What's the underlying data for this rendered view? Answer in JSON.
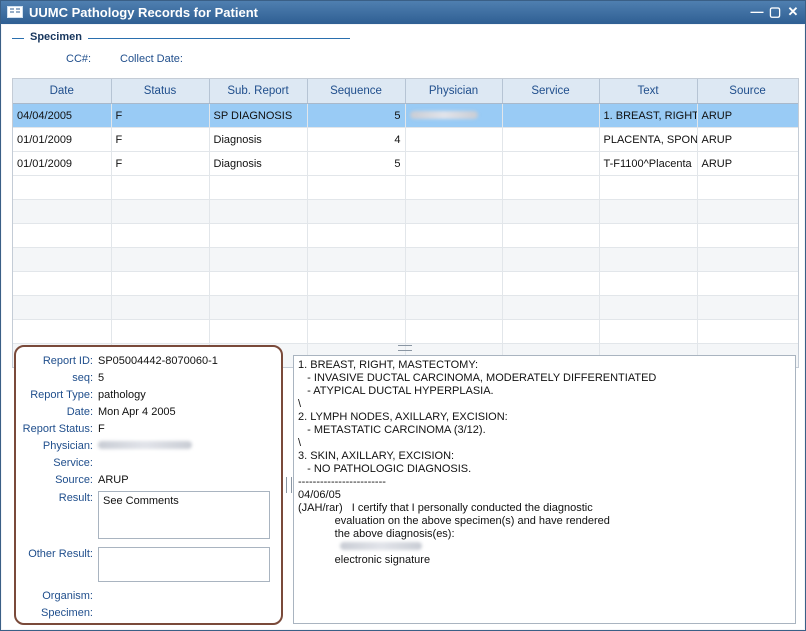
{
  "window": {
    "title": "UUMC Pathology Records for Patient"
  },
  "specimen": {
    "legend": "Specimen",
    "cc_label": "CC#:",
    "collect_label": "Collect Date:"
  },
  "grid": {
    "columns": [
      "Date",
      "Status",
      "Sub. Report",
      "Sequence",
      "Physician",
      "Service",
      "Text",
      "Source"
    ],
    "rows": [
      {
        "date": "04/04/2005",
        "status": "F",
        "sub": "SP DIAGNOSIS",
        "seq": "5",
        "physician": "blurred",
        "service": "",
        "text": "1. BREAST, RIGHT",
        "source": "ARUP",
        "selected": true
      },
      {
        "date": "01/01/2009",
        "status": "F",
        "sub": "Diagnosis",
        "seq": "4",
        "physician": "",
        "service": "",
        "text": "PLACENTA, SPON",
        "source": "ARUP",
        "selected": false
      },
      {
        "date": "01/01/2009",
        "status": "F",
        "sub": "Diagnosis",
        "seq": "5",
        "physician": "",
        "service": "",
        "text": "T-F1100^Placenta",
        "source": "ARUP",
        "selected": false
      }
    ]
  },
  "details": {
    "report_id_label": "Report ID:",
    "report_id": "SP05004442-8070060-1",
    "seq_label": "seq:",
    "seq": "5",
    "report_type_label": "Report Type:",
    "report_type": "pathology",
    "date_label": "Date:",
    "date": "Mon Apr 4 2005",
    "status_label": "Report Status:",
    "status": "F",
    "physician_label": "Physician:",
    "service_label": "Service:",
    "source_label": "Source:",
    "source": "ARUP",
    "result_label": "Result:",
    "result": "See Comments",
    "other_result_label": "Other Result:",
    "organism_label": "Organism:",
    "specimen_label": "Specimen:"
  },
  "report_text": [
    "1. BREAST, RIGHT, MASTECTOMY:",
    "   - INVASIVE DUCTAL CARCINOMA, MODERATELY DIFFERENTIATED",
    "   - ATYPICAL DUCTAL HYPERPLASIA.",
    "\\",
    "2. LYMPH NODES, AXILLARY, EXCISION:",
    "   - METASTATIC CARCINOMA (3/12).",
    "\\",
    "3. SKIN, AXILLARY, EXCISION:",
    "   - NO PATHOLOGIC DIAGNOSIS.",
    "------------------------",
    "04/06/05",
    "(JAH/rar)   I certify that I personally conducted the diagnostic",
    "            evaluation on the above specimen(s) and have rendered",
    "            the above diagnosis(es):",
    "",
    "            electronic signature"
  ]
}
